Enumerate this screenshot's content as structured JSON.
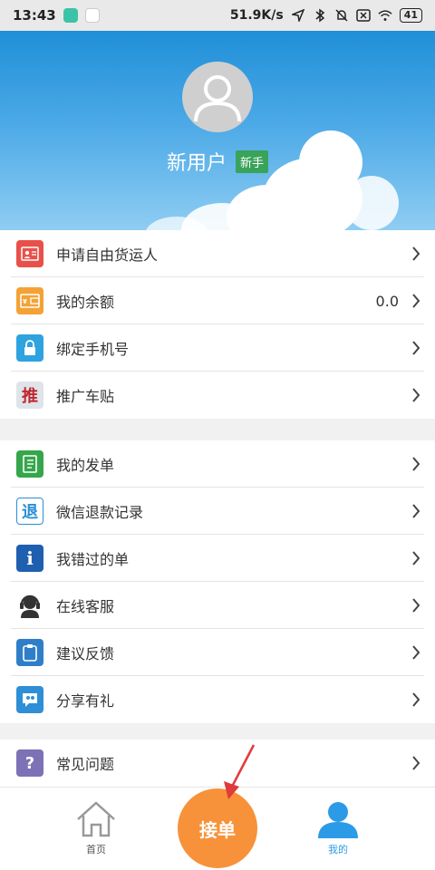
{
  "status_bar": {
    "time": "13:43",
    "net_speed": "51.9K/s",
    "battery": "41"
  },
  "profile": {
    "user_name": "新用户",
    "badge": "新手"
  },
  "groups": [
    {
      "items": [
        {
          "label": "申请自由货运人",
          "icon": "id-card-icon",
          "color": "#e8514a"
        },
        {
          "label": "我的余额",
          "value": "0.0",
          "icon": "wallet-icon",
          "color": "#f4a236"
        },
        {
          "label": "绑定手机号",
          "icon": "lock-icon",
          "color": "#2fa3e0"
        },
        {
          "label": "推广车贴",
          "icon": "promote-icon",
          "icon_text": "推",
          "color": "#c0272d"
        }
      ]
    },
    {
      "items": [
        {
          "label": "我的发单",
          "icon": "notebook-icon",
          "color": "#35a64b"
        },
        {
          "label": "微信退款记录",
          "icon": "refund-icon",
          "icon_text": "退",
          "color": "#2b8fd5"
        },
        {
          "label": "我错过的单",
          "icon": "info-icon",
          "icon_text": "i",
          "color": "#1e5fb0"
        },
        {
          "label": "在线客服",
          "icon": "headset-icon",
          "color": "#333333"
        },
        {
          "label": "建议反馈",
          "icon": "clipboard-icon",
          "color": "#2f7fc8"
        },
        {
          "label": "分享有礼",
          "icon": "share-icon",
          "color": "#2e8fd6"
        }
      ]
    },
    {
      "items": [
        {
          "label": "常见问题",
          "icon": "question-icon",
          "icon_text": "?",
          "color": "#7d72b6"
        }
      ]
    }
  ],
  "bottom_nav": {
    "home": "首页",
    "accept": "接单",
    "mine": "我的",
    "active_color": "#2b9be8"
  }
}
